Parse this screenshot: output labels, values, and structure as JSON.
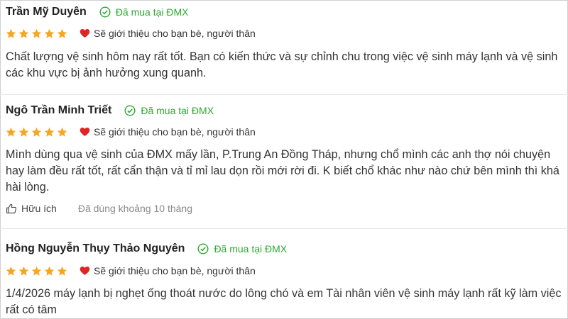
{
  "reviews": [
    {
      "name": "Trần Mỹ Duyên",
      "purchase_badge": "Đã mua tại ĐMX",
      "rating": 5,
      "recommend": "Sẽ giới thiệu cho bạn bè, người thân",
      "content_lines": [
        "Chất lượng vệ sinh hôm nay rất tốt. Bạn có kiến thức và sự chỉnh chu trong việc vệ sinh máy lạnh và vệ sinh",
        "các khu vực bị ảnh hưởng xung quanh."
      ]
    },
    {
      "name": "Ngô Trần Minh Triết",
      "purchase_badge": "Đã mua tại ĐMX",
      "rating": 5,
      "recommend": "Sẽ giới thiệu cho bạn bè, người thân",
      "content_lines": [
        "Mình dùng qua vệ sinh của ĐMX mấy lần, P.Trung An Đồng Tháp, nhưng chổ mình các anh thợ nói chuyện",
        "hay làm đều rất tốt, rất cẩn thận và tỉ mỉ lau dọn rồi mới rời đi. K biết chổ khác như nào chứ bên mình thì khá",
        "hài lòng."
      ],
      "helpful_label": "Hữu ích",
      "usage": "Đã dùng khoảng 10 tháng"
    },
    {
      "name": "Hồng Nguyễn Thụy Thảo Nguyên",
      "purchase_badge": "Đã mua tại ĐMX",
      "rating": 5,
      "recommend": "Sẽ giới thiệu cho bạn bè, người thân",
      "content_lines": [
        "1/4/2026 máy lạnh bị nghẹt ống thoát nước do lông chó và em Tài nhân viên vệ sinh máy lạnh rất kỹ làm việc",
        "rất có tâm"
      ]
    }
  ],
  "colors": {
    "star": "#f5a623",
    "heart": "#e02424",
    "verified": "#2ba832",
    "usage_text": "#8a8a8a"
  },
  "icons": {
    "star": "star-icon",
    "verified": "check-circle-icon",
    "heart": "heart-icon",
    "helpful": "thumbs-up-icon"
  }
}
